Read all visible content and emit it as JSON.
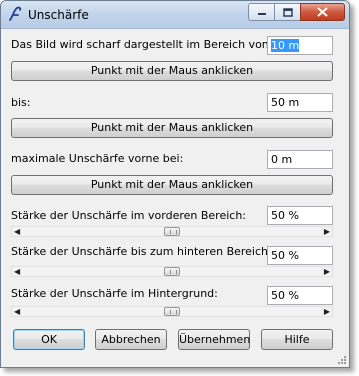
{
  "window": {
    "title": "Unschärfe",
    "icon": "script-f-icon"
  },
  "titlebar_buttons": {
    "minimize": "minimize-icon",
    "maximize": "maximize-icon",
    "close": "close-icon"
  },
  "sections": [
    {
      "label": "Das Bild wird scharf dargestellt im Bereich von:",
      "value": "10 m",
      "button": "Punkt mit der Maus anklicken"
    },
    {
      "label": "bis:",
      "value": "50 m",
      "button": "Punkt mit der Maus anklicken"
    },
    {
      "label": "maximale Unschärfe vorne bei:",
      "value": "0 m",
      "button": "Punkt mit der Maus anklicken"
    }
  ],
  "sliders": [
    {
      "label": "Stärke der Unschärfe im vorderen Bereich:",
      "value": "50 %",
      "level": 0.5
    },
    {
      "label": "Stärke der Unschärfe bis zum hinteren Bereich:",
      "value": "50 %",
      "level": 0.5
    },
    {
      "label": "Stärke der Unschärfe im Hintergrund:",
      "value": "50 %",
      "level": 0.5
    }
  ],
  "buttons": {
    "ok": "OK",
    "cancel": "Abbrechen",
    "apply": "Übernehmen",
    "help": "Hilfe"
  },
  "colors": {
    "selection": "#3399ff",
    "title_gradient": "#c0d3ea",
    "close": "#c8452a"
  }
}
